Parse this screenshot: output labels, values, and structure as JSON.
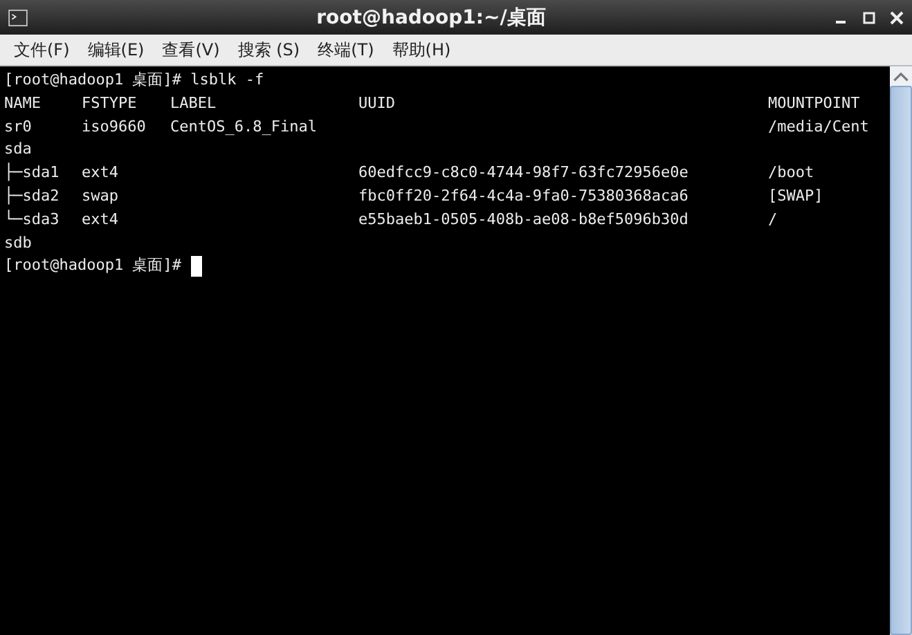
{
  "window": {
    "title": "root@hadoop1:~/桌面"
  },
  "menu": [
    "文件(F)",
    "编辑(E)",
    "查看(V)",
    "搜索 (S)",
    "终端(T)",
    "帮助(H)"
  ],
  "terminal": {
    "command_line": "[root@hadoop1 桌面]# lsblk -f",
    "columns": [
      "NAME",
      "FSTYPE",
      "LABEL",
      "UUID",
      "MOUNTPOINT"
    ],
    "rows": [
      {
        "name": "sr0",
        "fstype": "iso9660",
        "label": "CentOS_6.8_Final",
        "mountpoint": "/media/Cent"
      },
      {
        "name": "sda"
      },
      {
        "name": "├─sda1",
        "fstype": "ext4",
        "uuid": "60edfcc9-c8c0-4744-98f7-63fc72956e0e",
        "mountpoint": "/boot"
      },
      {
        "name": "├─sda2",
        "fstype": "swap",
        "uuid": "fbc0ff20-2f64-4c4a-9fa0-75380368aca6",
        "mountpoint": "[SWAP]"
      },
      {
        "name": "└─sda3",
        "fstype": "ext4",
        "uuid": "e55baeb1-0505-408b-ae08-b8ef5096b30d",
        "mountpoint": "/"
      },
      {
        "name": "sdb"
      }
    ],
    "prompt": "[root@hadoop1 桌面]#"
  }
}
